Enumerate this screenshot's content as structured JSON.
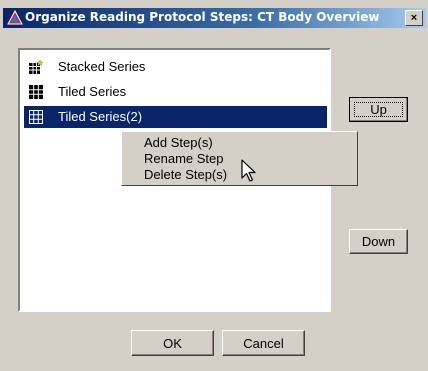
{
  "window": {
    "title": "Organize Reading Protocol Steps: CT Body Overview",
    "close_label": "×"
  },
  "list": {
    "items": [
      {
        "label": "Stacked Series",
        "icon": "stacked-series-icon",
        "selected": false
      },
      {
        "label": "Tiled Series",
        "icon": "tiled-series-icon",
        "selected": false
      },
      {
        "label": "Tiled Series(2)",
        "icon": "tiled-series-icon",
        "selected": true
      }
    ]
  },
  "context_menu": {
    "items": [
      {
        "label": "Add Step(s)"
      },
      {
        "label": "Rename Step"
      },
      {
        "label": "Delete Step(s)"
      }
    ]
  },
  "buttons": {
    "up": "Up",
    "down": "Down",
    "ok": "OK",
    "cancel": "Cancel"
  },
  "colors": {
    "selection": "#0a246a",
    "dialog_face": "#d4d0c8"
  }
}
